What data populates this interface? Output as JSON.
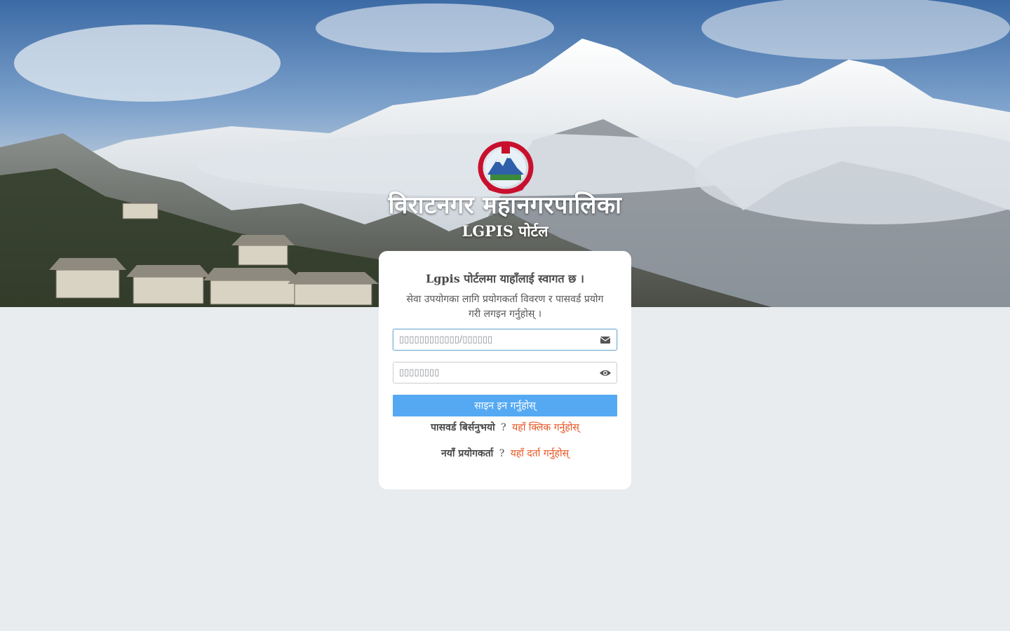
{
  "header": {
    "city_name": "विराटनगर महानगरपालिका",
    "portal_name": "LGPIS पोर्टल",
    "emblem_icon": "nepal-emblem-icon"
  },
  "login": {
    "welcome": "Lgpis पोर्टलमा याहाँलाई स्वागत छ ।",
    "instruction": "सेवा उपयोगका लागि प्रयोगकर्ता विवरण र पासवर्ड प्रयोग गरी लगइन गर्नुहोस् ।",
    "username_placeholder": "▯▯▯▯▯▯▯▯▯▯▯▯/▯▯▯▯▯▯",
    "username_icon": "envelope-icon",
    "password_placeholder": "▯▯▯▯▯▯▯▯",
    "password_icon": "eye-icon",
    "signin_label": "साइन इन गर्नुहोस्",
    "forgot_text": "पासवर्ड बिर्सनुभयो",
    "forgot_link": "यहाँ क्लिक गर्नुहोस्",
    "new_user_text": "नयाँ प्रयोगकर्ता",
    "register_link": "यहाँ दर्ता गर्नुहोस्",
    "question_mark": "?"
  },
  "colors": {
    "button": "#55a9f3",
    "link": "#e8531f",
    "page_bg": "#e8ecef"
  }
}
